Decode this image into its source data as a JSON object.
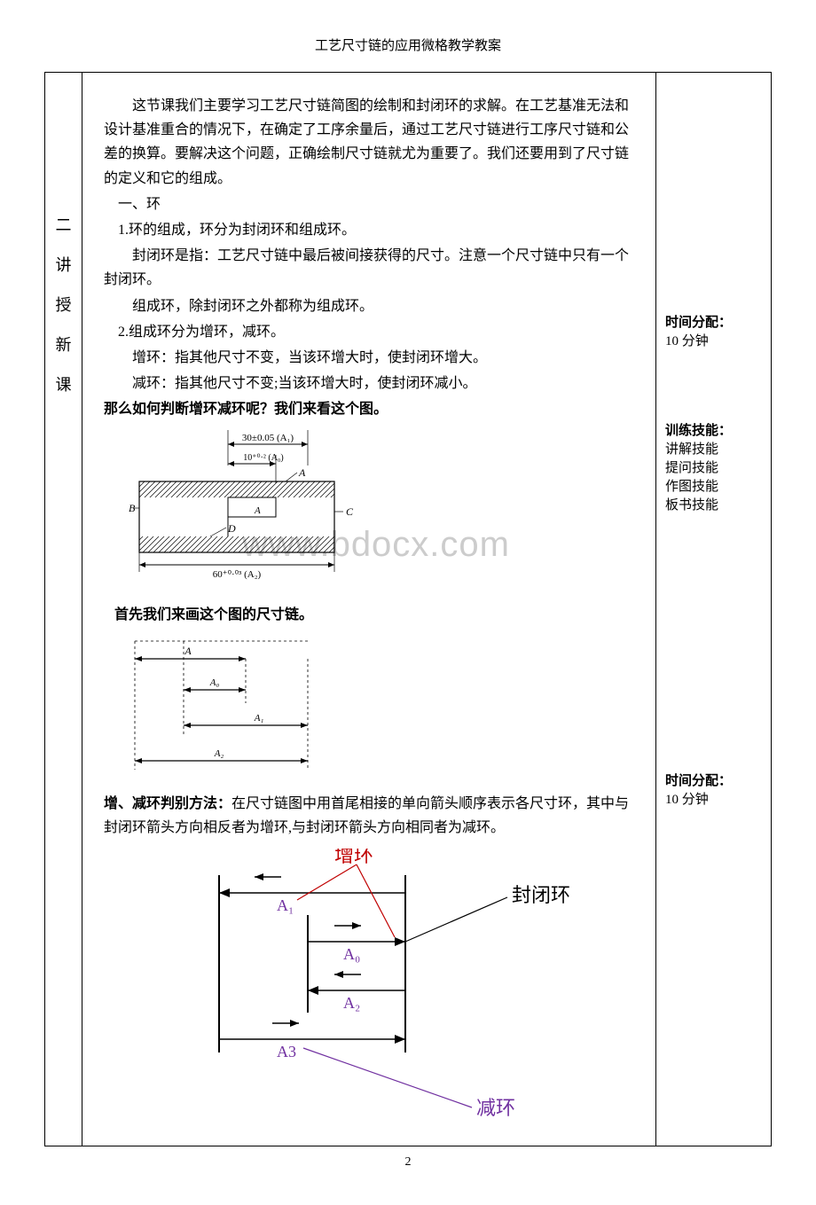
{
  "header": "工艺尺寸链的应用微格教学教案",
  "leftCol": [
    "二",
    "讲",
    "授",
    "新",
    "课"
  ],
  "intro": "这节课我们主要学习工艺尺寸链简图的绘制和封闭环的求解。在工艺基准无法和设计基准重合的情况下，在确定了工序余量后，通过工艺尺寸链进行工序尺寸链和公差的换算。要解决这个问题，正确绘制尺寸链就尤为重要了。我们还要用到了尺寸链的定义和它的组成。",
  "sec1_title": "一、环",
  "sec1_1": "1.环的组成，环分为封闭环和组成环。",
  "sec1_1a": "封闭环是指：工艺尺寸链中最后被间接获得的尺寸。注意一个尺寸链中只有一个封闭环。",
  "sec1_1b": "组成环，除封闭环之外都称为组成环。",
  "sec1_2": "2.组成环分为增环，减环。",
  "sec1_2a": "增环：指其他尺寸不变，当该环增大时，使封闭环增大。",
  "sec1_2b": "减环：指其他尺寸不变;当该环增大时，使封闭环减小。",
  "question": "那么如何判断增环减环呢？我们来看这个图。",
  "fig1_dim1": "30±0.05 (A₁)",
  "fig1_dim2": "10⁺⁰·² (A₀)",
  "fig1_dim3": "60⁺⁰·⁰³ (A₂)",
  "fig1_labelA": "A",
  "fig1_labelB": "B",
  "fig1_labelC": "C",
  "fig1_labelD": "D",
  "fig1_labelAsub": "A",
  "caption1": "首先我们来画这个图的尺寸链。",
  "fig2_A": "A",
  "fig2_A0": "A₀",
  "fig2_A1": "A₁",
  "fig2_A2": "A₂",
  "method_label": "增、减环判别方法：",
  "method_text": "在尺寸链图中用首尾相接的单向箭头顺序表示各尺寸环，其中与封闭环箭头方向相反者为增环,与封闭环箭头方向相同者为减环。",
  "fig3_zenghuan": "增环",
  "fig3_fengbihuan": "封闭环",
  "fig3_jianhuan": "减环",
  "fig3_A0": "A₀",
  "fig3_A1": "A₁",
  "fig3_A2": "A₂",
  "fig3_A3": "A3",
  "right_time_label": "时间分配：",
  "right_time_val": "10 分钟",
  "right_skill_label": "训练技能：",
  "right_skill_1": "讲解技能",
  "right_skill_2": "提问技能",
  "right_skill_3": "作图技能",
  "right_skill_4": "板书技能",
  "pageNumber": "2",
  "watermark": "www.bdocx.com"
}
